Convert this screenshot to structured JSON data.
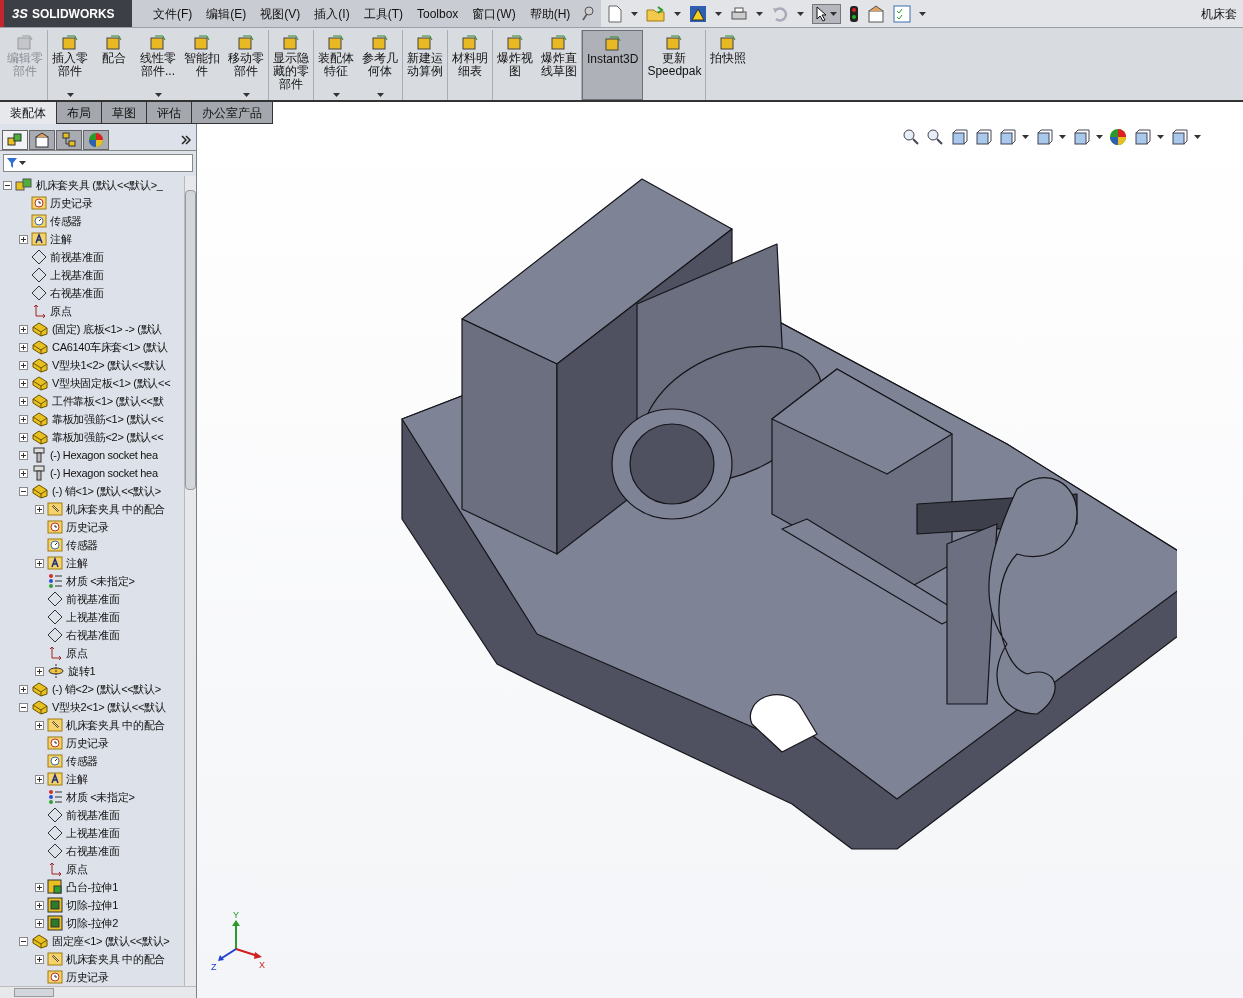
{
  "app": {
    "logo": "SOLIDWORKS",
    "logo_prefix": "3S",
    "document_title": "机床套"
  },
  "menu": [
    "文件(F)",
    "编辑(E)",
    "视图(V)",
    "插入(I)",
    "工具(T)",
    "Toolbox",
    "窗口(W)",
    "帮助(H)"
  ],
  "command_manager": [
    {
      "lines": [
        "编辑零",
        "部件"
      ],
      "disabled": true,
      "dropdown": false,
      "selected": false
    },
    {
      "lines": [
        "插入零",
        "部件"
      ],
      "disabled": false,
      "dropdown": true,
      "selected": false
    },
    {
      "lines": [
        "配合"
      ],
      "disabled": false,
      "dropdown": false,
      "selected": false
    },
    {
      "lines": [
        "线性零",
        "部件..."
      ],
      "disabled": false,
      "dropdown": true,
      "selected": false
    },
    {
      "lines": [
        "智能扣",
        "件"
      ],
      "disabled": false,
      "dropdown": false,
      "selected": false
    },
    {
      "lines": [
        "移动零",
        "部件"
      ],
      "disabled": false,
      "dropdown": true,
      "selected": false
    },
    {
      "lines": [
        "显示隐",
        "藏的零",
        "部件"
      ],
      "disabled": false,
      "dropdown": false,
      "selected": false
    },
    {
      "lines": [
        "装配体",
        "特征"
      ],
      "disabled": false,
      "dropdown": true,
      "selected": false
    },
    {
      "lines": [
        "参考几",
        "何体"
      ],
      "disabled": false,
      "dropdown": true,
      "selected": false
    },
    {
      "lines": [
        "新建运",
        "动算例"
      ],
      "disabled": false,
      "dropdown": false,
      "selected": false
    },
    {
      "lines": [
        "材料明",
        "细表"
      ],
      "disabled": false,
      "dropdown": false,
      "selected": false
    },
    {
      "lines": [
        "爆炸视",
        "图"
      ],
      "disabled": false,
      "dropdown": false,
      "selected": false
    },
    {
      "lines": [
        "爆炸直",
        "线草图"
      ],
      "disabled": false,
      "dropdown": false,
      "selected": false
    },
    {
      "lines": [
        "Instant3D"
      ],
      "disabled": false,
      "dropdown": false,
      "selected": true
    },
    {
      "lines": [
        "更新",
        "Speedpak"
      ],
      "disabled": false,
      "dropdown": false,
      "selected": false
    },
    {
      "lines": [
        "拍快照"
      ],
      "disabled": false,
      "dropdown": false,
      "selected": false
    }
  ],
  "tabs": [
    {
      "label": "装配体",
      "selected": true
    },
    {
      "label": "布局",
      "selected": false
    },
    {
      "label": "草图",
      "selected": false
    },
    {
      "label": "评估",
      "selected": false
    },
    {
      "label": "办公室产品",
      "selected": false
    }
  ],
  "tree": [
    {
      "kind": "assembly",
      "label": "机床套夹具  (默认<<默认>_",
      "expanded": true,
      "children": [
        {
          "kind": "history",
          "label": "历史记录"
        },
        {
          "kind": "sensor",
          "label": "传感器"
        },
        {
          "kind": "annotation",
          "label": "注解",
          "expanded": false
        },
        {
          "kind": "plane",
          "label": "前视基准面"
        },
        {
          "kind": "plane",
          "label": "上视基准面"
        },
        {
          "kind": "plane",
          "label": "右视基准面"
        },
        {
          "kind": "origin",
          "label": "原点"
        },
        {
          "kind": "part",
          "label": "(固定) 底板<1> -> (默认",
          "expanded": false
        },
        {
          "kind": "part",
          "label": "CA6140车床套<1> (默认",
          "expanded": false
        },
        {
          "kind": "part",
          "label": "V型块1<2> (默认<<默认",
          "expanded": false
        },
        {
          "kind": "part",
          "label": "V型块固定板<1> (默认<<",
          "expanded": false
        },
        {
          "kind": "part",
          "label": "工件靠板<1> (默认<<默",
          "expanded": false
        },
        {
          "kind": "part",
          "label": "靠板加强筋<1> (默认<<",
          "expanded": false
        },
        {
          "kind": "part",
          "label": "靠板加强筋<2> (默认<<",
          "expanded": false
        },
        {
          "kind": "bolt",
          "label": "(-) Hexagon socket hea",
          "expanded": false
        },
        {
          "kind": "bolt",
          "label": "(-) Hexagon socket hea",
          "expanded": false
        },
        {
          "kind": "part",
          "label": "(-) 销<1> (默认<<默认>",
          "expanded": true,
          "children": [
            {
              "kind": "mates",
              "label": "机床套夹具 中的配合",
              "expanded": false
            },
            {
              "kind": "history",
              "label": "历史记录"
            },
            {
              "kind": "sensor",
              "label": "传感器"
            },
            {
              "kind": "annotation",
              "label": "注解",
              "expanded": false
            },
            {
              "kind": "material",
              "label": "材质 <未指定>"
            },
            {
              "kind": "plane",
              "label": "前视基准面"
            },
            {
              "kind": "plane",
              "label": "上视基准面"
            },
            {
              "kind": "plane",
              "label": "右视基准面"
            },
            {
              "kind": "origin",
              "label": "原点"
            },
            {
              "kind": "revolve",
              "label": "旋转1",
              "expanded": false
            }
          ]
        },
        {
          "kind": "part",
          "label": "(-) 销<2> (默认<<默认>",
          "expanded": false
        },
        {
          "kind": "part",
          "label": "V型块2<1> (默认<<默认",
          "expanded": true,
          "children": [
            {
              "kind": "mates",
              "label": "机床套夹具 中的配合",
              "expanded": false
            },
            {
              "kind": "history",
              "label": "历史记录"
            },
            {
              "kind": "sensor",
              "label": "传感器"
            },
            {
              "kind": "annotation",
              "label": "注解",
              "expanded": false
            },
            {
              "kind": "material",
              "label": "材质 <未指定>"
            },
            {
              "kind": "plane",
              "label": "前视基准面"
            },
            {
              "kind": "plane",
              "label": "上视基准面"
            },
            {
              "kind": "plane",
              "label": "右视基准面"
            },
            {
              "kind": "origin",
              "label": "原点"
            },
            {
              "kind": "boss",
              "label": "凸台-拉伸1",
              "expanded": false
            },
            {
              "kind": "cut",
              "label": "切除-拉伸1",
              "expanded": false
            },
            {
              "kind": "cut",
              "label": "切除-拉伸2",
              "expanded": false
            }
          ]
        },
        {
          "kind": "part",
          "label": "固定座<1> (默认<<默认>",
          "expanded": true,
          "children": [
            {
              "kind": "mates",
              "label": "机床套夹具 中的配合",
              "expanded": false
            },
            {
              "kind": "history",
              "label": "历史记录"
            }
          ]
        }
      ]
    }
  ],
  "triad": {
    "x": "X",
    "y": "Y",
    "z": "Z"
  }
}
